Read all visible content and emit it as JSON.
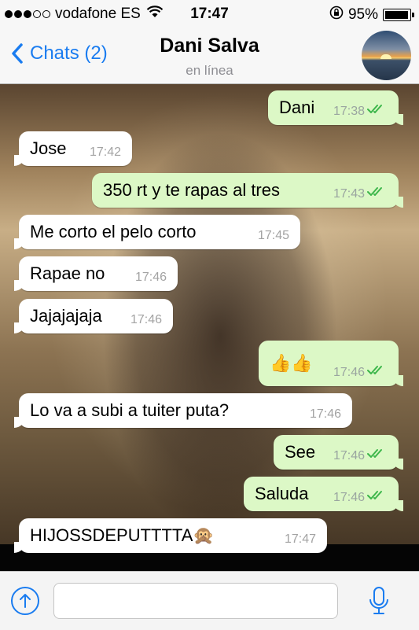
{
  "status_bar": {
    "carrier": "vodafone ES",
    "time": "17:47",
    "battery": "95%",
    "battery_level": 0.95,
    "signal_bars_filled": 3,
    "signal_bars_total": 5
  },
  "nav": {
    "back_label": "Chats (2)",
    "contact_name": "Dani Salva",
    "contact_status": "en línea"
  },
  "colors": {
    "accent": "#1a7cf0",
    "outgoing_bubble": "#dcf8c6",
    "incoming_bubble": "#ffffff",
    "read_ticks": "#3cb64a"
  },
  "messages": [
    {
      "direction": "out",
      "text": "Dani",
      "time": "17:38",
      "read": true
    },
    {
      "direction": "in",
      "text": "Jose",
      "time": "17:42"
    },
    {
      "direction": "out",
      "text": "350 rt y te rapas al tres",
      "time": "17:43",
      "read": true
    },
    {
      "direction": "in",
      "text": "Me corto el pelo corto",
      "time": "17:45"
    },
    {
      "direction": "in",
      "text": "Rapae no",
      "time": "17:46"
    },
    {
      "direction": "in",
      "text": "Jajajajaja",
      "time": "17:46"
    },
    {
      "direction": "out",
      "text": "👍👍",
      "time": "17:46",
      "read": true
    },
    {
      "direction": "in",
      "text": "Lo va a subi a tuiter puta?",
      "time": "17:46"
    },
    {
      "direction": "out",
      "text": "See",
      "time": "17:46",
      "read": true
    },
    {
      "direction": "out",
      "text": "Saluda",
      "time": "17:46",
      "read": true
    },
    {
      "direction": "in",
      "text": "HIJOSSDEPUTTTTA🙊",
      "time": "17:47"
    }
  ],
  "input": {
    "placeholder": "",
    "value": ""
  },
  "icons": {
    "back": "chevron-left-icon",
    "upload": "share-arrow-up-icon",
    "mic": "microphone-icon"
  }
}
